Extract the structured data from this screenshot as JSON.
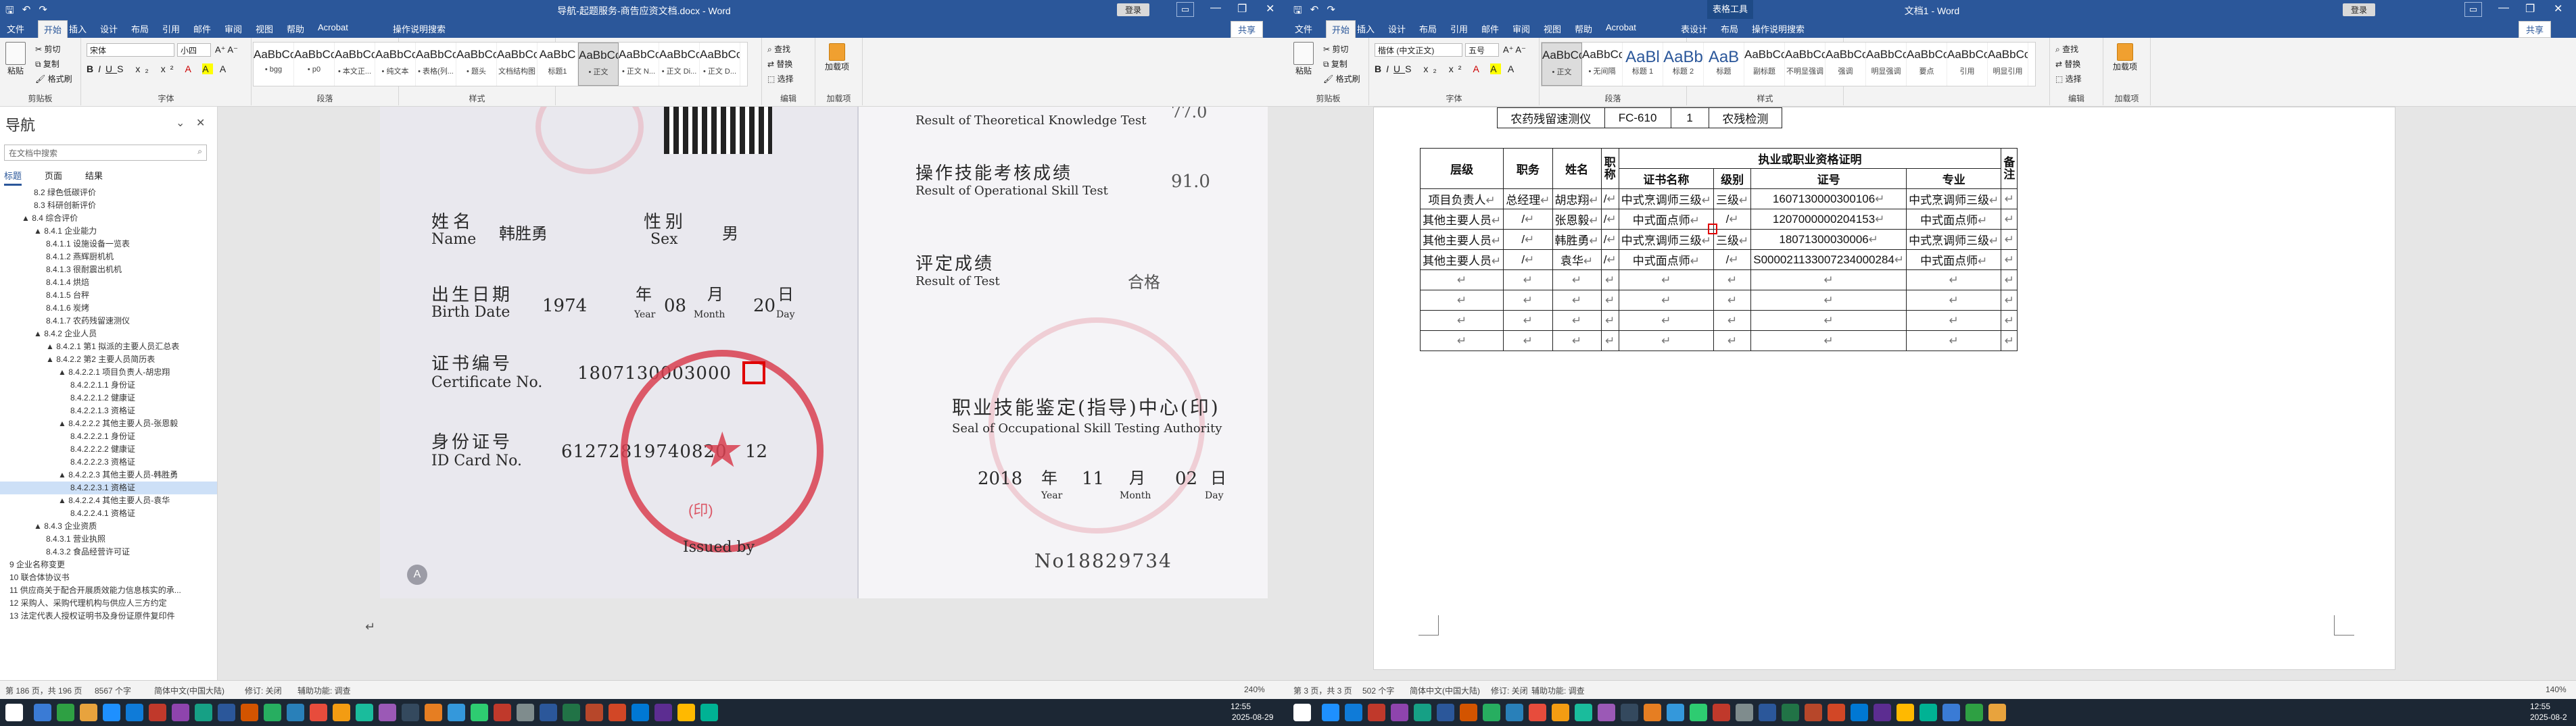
{
  "left_window": {
    "title": "导航-起题服务-商告应资文档.docx - Word",
    "login": "登录",
    "share": "共享",
    "tabs": [
      "文件",
      "开始",
      "插入",
      "设计",
      "布局",
      "引用",
      "邮件",
      "审阅",
      "视图",
      "帮助",
      "Acrobat",
      "操作说明搜索"
    ],
    "active_tab": "开始",
    "ribbon": {
      "paste": "粘贴",
      "cut": "剪切",
      "copy": "复制",
      "format_painter": "格式刷",
      "clipboard": "剪贴板",
      "font_name": "宋体",
      "font_size": "小四",
      "font_group": "字体",
      "paragraph_group": "段落",
      "styles_group": "样式",
      "find": "查找",
      "replace": "替换",
      "select": "选择",
      "editing_group": "编辑",
      "acrobat_group": "加载项",
      "acrobat_btn": "加载项",
      "styles": [
        {
          "preview": "AaBbCcDd",
          "name": "• bgg"
        },
        {
          "preview": "AaBbCcDd",
          "name": "• p0"
        },
        {
          "preview": "AaBbCcDc",
          "name": "• 本文正..."
        },
        {
          "preview": "AaBbCcD",
          "name": "• 纯文本"
        },
        {
          "preview": "AaBbCcI",
          "name": "• 表格(列..."
        },
        {
          "preview": "AaBbCc",
          "name": "• 题头"
        },
        {
          "preview": "AaBbCcDdEe",
          "name": "文档结构图"
        },
        {
          "preview": "AaBbC",
          "name": "标题1"
        },
        {
          "preview": "AaBbCcDd",
          "name": "• 正文"
        },
        {
          "preview": "AaBbCcDd",
          "name": "• 正文 N..."
        },
        {
          "preview": "AaBbCcDd",
          "name": "• 正文 Di..."
        },
        {
          "preview": "AaBbCcDd",
          "name": "• 正文 D..."
        }
      ]
    },
    "nav": {
      "title": "导航",
      "search_placeholder": "在文档中搜索",
      "tabs": [
        "标题",
        "页面",
        "结果"
      ],
      "items": [
        {
          "t": "8.2 绿色低碳评价",
          "lvl": 2
        },
        {
          "t": "8.3 科研创新评价",
          "lvl": 2
        },
        {
          "t": "▲ 8.4 综合评价",
          "lvl": 1
        },
        {
          "t": "▲ 8.4.1 企业能力",
          "lvl": 2
        },
        {
          "t": "8.4.1.1 设施设备一览表",
          "lvl": 3
        },
        {
          "t": "8.4.1.2 燕辉厨机机",
          "lvl": 3
        },
        {
          "t": "8.4.1.3 很耐震出机机",
          "lvl": 3
        },
        {
          "t": "8.4.1.4 烘焙",
          "lvl": 3
        },
        {
          "t": "8.4.1.5 台秤",
          "lvl": 3
        },
        {
          "t": "8.4.1.6 炭烤",
          "lvl": 3
        },
        {
          "t": "8.4.1.7 农药残留速测仪",
          "lvl": 3
        },
        {
          "t": "▲ 8.4.2 企业人员",
          "lvl": 2
        },
        {
          "t": "▲ 8.4.2.1 第1 拟派的主要人员汇总表",
          "lvl": 3
        },
        {
          "t": "▲ 8.4.2.2 第2 主要人员简历表",
          "lvl": 3
        },
        {
          "t": "▲ 8.4.2.2.1 项目负责人-胡忠翔",
          "lvl": 4
        },
        {
          "t": "8.4.2.2.1.1 身份证",
          "lvl": 5
        },
        {
          "t": "8.4.2.2.1.2 健康证",
          "lvl": 5
        },
        {
          "t": "8.4.2.2.1.3 资格证",
          "lvl": 5
        },
        {
          "t": "▲ 8.4.2.2.2 其他主要人员-张恩毅",
          "lvl": 4
        },
        {
          "t": "8.4.2.2.2.1 身份证",
          "lvl": 5
        },
        {
          "t": "8.4.2.2.2.2 健康证",
          "lvl": 5
        },
        {
          "t": "8.4.2.2.2.3 资格证",
          "lvl": 5
        },
        {
          "t": "▲ 8.4.2.2.3 其他主要人员-韩胜勇",
          "lvl": 4
        },
        {
          "t": "8.4.2.2.3.1 资格证",
          "lvl": 5,
          "hl": true
        },
        {
          "t": "▲ 8.4.2.2.4 其他主要人员-袁华",
          "lvl": 4
        },
        {
          "t": "8.4.2.2.4.1 资格证",
          "lvl": 5
        },
        {
          "t": "▲ 8.4.3 企业资质",
          "lvl": 2
        },
        {
          "t": "8.4.3.1 营业执照",
          "lvl": 3
        },
        {
          "t": "8.4.3.2 食品经营许可证",
          "lvl": 3
        },
        {
          "t": "9 企业名称变更",
          "lvl": 0
        },
        {
          "t": "10 联合体协议书",
          "lvl": 0
        },
        {
          "t": "11 供应商关于配合开展质效能力信息核实的承...",
          "lvl": 0
        },
        {
          "t": "12 采购人、采购代理机构与供应人三方约定",
          "lvl": 0
        },
        {
          "t": "13 法定代表人授权证明书及身份证原件复印件",
          "lvl": 0
        }
      ]
    },
    "certificate": {
      "theory_label": "Result of Theoretical Knowledge Test",
      "theory_score": "77.0",
      "op_cn": "操作技能考核成绩",
      "op_en": "Result of Operational Skill Test",
      "op_score": "91.0",
      "eval_cn": "评定成绩",
      "eval_en": "Result of Test",
      "eval_result": "合格",
      "org_cn": "职业技能鉴定(指导)中心(印)",
      "org_en": "Seal of Occupational Skill Testing Authority",
      "issue_date_year": "2018",
      "issue_year_cn": "年",
      "issue_date_month": "11",
      "issue_month_cn": "月",
      "issue_date_day": "02",
      "issue_day_cn": "日",
      "issue_year_en": "Year",
      "issue_month_en": "Month",
      "issue_day_en": "Day",
      "serial": "No18829734",
      "name_cn": "姓名",
      "name_en": "Name",
      "name_value": "韩胜勇",
      "sex_cn": "性别",
      "sex_en": "Sex",
      "sex_value": "男",
      "birth_cn": "出生日期",
      "birth_en": "Birth Date",
      "birth_year": "1974",
      "birth_month": "08",
      "birth_day": "20",
      "year_cn": "年",
      "month_cn": "月",
      "day_cn": "日",
      "year_en": "Year",
      "month_en": "Month",
      "day_en": "Day",
      "cert_cn": "证书编号",
      "cert_en": "Certificate No.",
      "cert_value": "1807130003000",
      "id_cn": "身份证号",
      "id_en": "ID Card No.",
      "id_value": "61272819740820",
      "id_suffix": "12",
      "issued_by": "Issued by",
      "stamp_text": "(印)"
    },
    "status": {
      "page": "第 186 页，共 196 页",
      "words": "8567 个字",
      "lang": "简体中文(中国大陆)",
      "track": "修订: 关闭",
      "access": "辅助功能: 调查",
      "zoom": "240%"
    }
  },
  "right_window": {
    "title": "文档1 - Word",
    "context_tab": "表格工具",
    "login": "登录",
    "share": "共享",
    "tabs": [
      "文件",
      "开始",
      "插入",
      "设计",
      "布局",
      "引用",
      "邮件",
      "审阅",
      "视图",
      "帮助",
      "Acrobat",
      "表设计",
      "布局",
      "操作说明搜索"
    ],
    "active_tab": "开始",
    "ribbon": {
      "paste": "粘贴",
      "cut": "剪切",
      "copy": "复制",
      "format_painter": "格式刷",
      "clipboard": "剪贴板",
      "font_name": "楷体 (中文正文)",
      "font_size": "五号",
      "font_group": "字体",
      "paragraph_group": "段落",
      "styles_group": "样式",
      "find": "查找",
      "replace": "替换",
      "select": "选择",
      "editing_group": "编辑",
      "acrobat_group": "加载项",
      "acrobat_btn": "加载项",
      "styles": [
        {
          "preview": "AaBbCcDd",
          "name": "• 正文"
        },
        {
          "preview": "AaBbCcDd",
          "name": "• 无间隔"
        },
        {
          "preview": "AaBl",
          "name": "标题 1"
        },
        {
          "preview": "AaBb",
          "name": "标题 2"
        },
        {
          "preview": "AaB",
          "name": "标题"
        },
        {
          "preview": "AaBbCc",
          "name": "副标题"
        },
        {
          "preview": "AaBbCcD",
          "name": "不明显强调"
        },
        {
          "preview": "AaBbCcD",
          "name": "强调"
        },
        {
          "preview": "AaBbCcD",
          "name": "明显强调"
        },
        {
          "preview": "AaBbCcD",
          "name": "要点"
        },
        {
          "preview": "AaBbCcD",
          "name": "引用"
        },
        {
          "preview": "AaBbCcD",
          "name": "明显引用"
        }
      ]
    },
    "table": {
      "top_fragment": [
        "农药残留速测仪",
        "FC-610",
        "1",
        "农残检测"
      ],
      "headers": {
        "level": "层级",
        "title": "职务",
        "name": "姓名",
        "rank": "职称",
        "group": "执业或职业资格证明",
        "cert_name": "证书名称",
        "grade": "级别",
        "cert_no": "证号",
        "major": "专业",
        "note": "备注"
      },
      "rows": [
        [
          "项目负责人",
          "总经理",
          "胡忠翔",
          "/",
          "中式烹调师三级",
          "三级",
          "1607130000300106",
          "中式烹调师三级",
          ""
        ],
        [
          "其他主要人员",
          "/",
          "张恩毅",
          "/",
          "中式面点师",
          "/",
          "1207000000204153",
          "中式面点师",
          ""
        ],
        [
          "其他主要人员",
          "/",
          "韩胜勇",
          "/",
          "中式烹调师三级",
          "三级",
          "18071300030006",
          "中式烹调师三级",
          ""
        ],
        [
          "其他主要人员",
          "/",
          "袁华",
          "/",
          "中式面点师",
          "/",
          "S000021133007234000284",
          "中式面点师",
          ""
        ],
        [
          "",
          "",
          "",
          "",
          "",
          "",
          "",
          "",
          ""
        ],
        [
          "",
          "",
          "",
          "",
          "",
          "",
          "",
          "",
          ""
        ],
        [
          "",
          "",
          "",
          "",
          "",
          "",
          "",
          "",
          ""
        ],
        [
          "",
          "",
          "",
          "",
          "",
          "",
          "",
          "",
          ""
        ]
      ]
    },
    "status": {
      "page": "第 3 页，共 3 页",
      "words": "502 个字",
      "lang": "简体中文(中国大陆)",
      "track": "修订: 关闭",
      "access": "辅助功能: 调查",
      "zoom": "140%"
    }
  },
  "taskbar": {
    "time_left": "12:55",
    "date_left": "2025-08-29",
    "time_right": "12:55",
    "date_right": "2025-08-2",
    "colors": [
      "#3a7bd5",
      "#2ea043",
      "#e8a33d",
      "#1e90ff",
      "#0f7bd8",
      "#c0392b",
      "#8e44ad",
      "#16a085",
      "#2b579a",
      "#d35400",
      "#27ae60",
      "#2980b9",
      "#e74c3c",
      "#f39c12",
      "#1abc9c",
      "#9b59b6",
      "#34495e",
      "#e67e22",
      "#3498db",
      "#2ecc71",
      "#c0392b",
      "#7f8c8d",
      "#2b579a",
      "#217346",
      "#b7472a",
      "#d24726",
      "#0078d4",
      "#5c2d91",
      "#ffb900",
      "#00b294"
    ]
  }
}
